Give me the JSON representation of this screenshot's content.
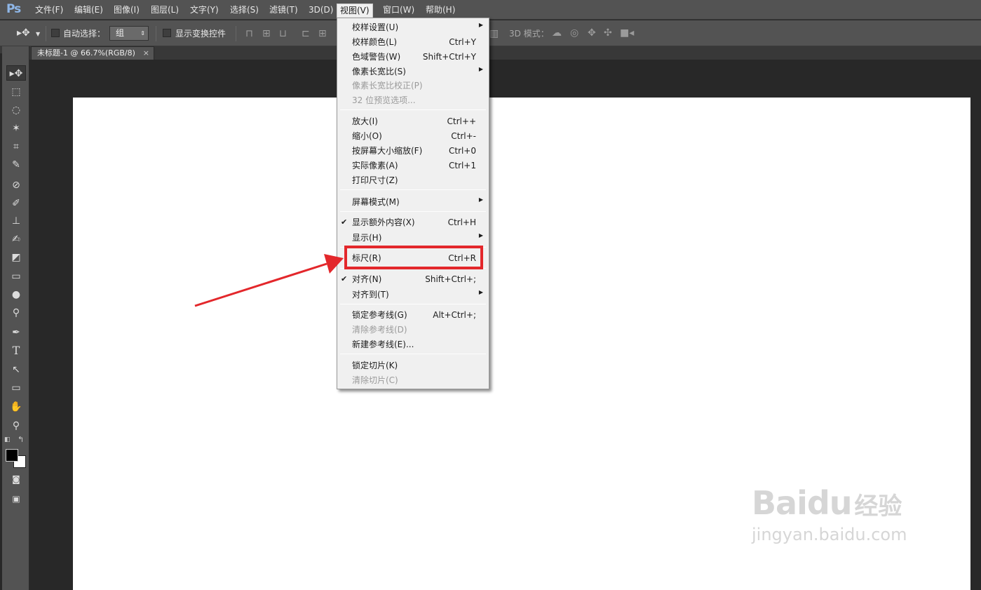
{
  "app": {
    "logo": "Ps"
  },
  "menubar": {
    "items": [
      "文件(F)",
      "编辑(E)",
      "图像(I)",
      "图层(L)",
      "文字(Y)",
      "选择(S)",
      "滤镜(T)",
      "3D(D)",
      "视图(V)",
      "窗口(W)",
      "帮助(H)"
    ],
    "active_index": 8
  },
  "options": {
    "auto_select_label": "自动选择：",
    "auto_select_value": "组",
    "show_transform_label": "显示变换控件",
    "mode_3d_label": "3D 模式："
  },
  "document": {
    "tab_title": "未标题-1 @ 66.7%(RGB/8)",
    "close_glyph": "×"
  },
  "view_menu": {
    "items": [
      {
        "label": "校样设置(U)",
        "shortcut": "",
        "submenu": true,
        "disabled": false,
        "checked": false
      },
      {
        "label": "校样颜色(L)",
        "shortcut": "Ctrl+Y",
        "submenu": false,
        "disabled": false,
        "checked": false
      },
      {
        "label": "色域警告(W)",
        "shortcut": "Shift+Ctrl+Y",
        "submenu": false,
        "disabled": false,
        "checked": false
      },
      {
        "label": "像素长宽比(S)",
        "shortcut": "",
        "submenu": true,
        "disabled": false,
        "checked": false
      },
      {
        "label": "像素长宽比校正(P)",
        "shortcut": "",
        "submenu": false,
        "disabled": true,
        "checked": false
      },
      {
        "label": "32 位预览选项...",
        "shortcut": "",
        "submenu": false,
        "disabled": true,
        "checked": false
      },
      {
        "label": "放大(I)",
        "shortcut": "Ctrl++",
        "submenu": false,
        "disabled": false,
        "checked": false
      },
      {
        "label": "缩小(O)",
        "shortcut": "Ctrl+-",
        "submenu": false,
        "disabled": false,
        "checked": false
      },
      {
        "label": "按屏幕大小缩放(F)",
        "shortcut": "Ctrl+0",
        "submenu": false,
        "disabled": false,
        "checked": false
      },
      {
        "label": "实际像素(A)",
        "shortcut": "Ctrl+1",
        "submenu": false,
        "disabled": false,
        "checked": false
      },
      {
        "label": "打印尺寸(Z)",
        "shortcut": "",
        "submenu": false,
        "disabled": false,
        "checked": false
      },
      {
        "label": "屏幕模式(M)",
        "shortcut": "",
        "submenu": true,
        "disabled": false,
        "checked": false
      },
      {
        "label": "显示额外内容(X)",
        "shortcut": "Ctrl+H",
        "submenu": false,
        "disabled": false,
        "checked": true
      },
      {
        "label": "显示(H)",
        "shortcut": "",
        "submenu": true,
        "disabled": false,
        "checked": false
      },
      {
        "label": "标尺(R)",
        "shortcut": "Ctrl+R",
        "submenu": false,
        "disabled": false,
        "checked": false
      },
      {
        "label": "对齐(N)",
        "shortcut": "Shift+Ctrl+;",
        "submenu": false,
        "disabled": false,
        "checked": true
      },
      {
        "label": "对齐到(T)",
        "shortcut": "",
        "submenu": true,
        "disabled": false,
        "checked": false
      },
      {
        "label": "锁定参考线(G)",
        "shortcut": "Alt+Ctrl+;",
        "submenu": false,
        "disabled": false,
        "checked": false
      },
      {
        "label": "清除参考线(D)",
        "shortcut": "",
        "submenu": false,
        "disabled": true,
        "checked": false
      },
      {
        "label": "新建参考线(E)...",
        "shortcut": "",
        "submenu": false,
        "disabled": false,
        "checked": false
      },
      {
        "label": "锁定切片(K)",
        "shortcut": "",
        "submenu": false,
        "disabled": false,
        "checked": false
      },
      {
        "label": "清除切片(C)",
        "shortcut": "",
        "submenu": false,
        "disabled": true,
        "checked": false
      }
    ],
    "highlighted_label": "标尺(R)"
  },
  "watermark": {
    "brand": "Baidu",
    "product": "经验",
    "url": "jingyan.baidu.com"
  },
  "colors": {
    "annotation": "#e3272b",
    "menu_bg": "#f0f0f0",
    "chrome": "#535353"
  }
}
